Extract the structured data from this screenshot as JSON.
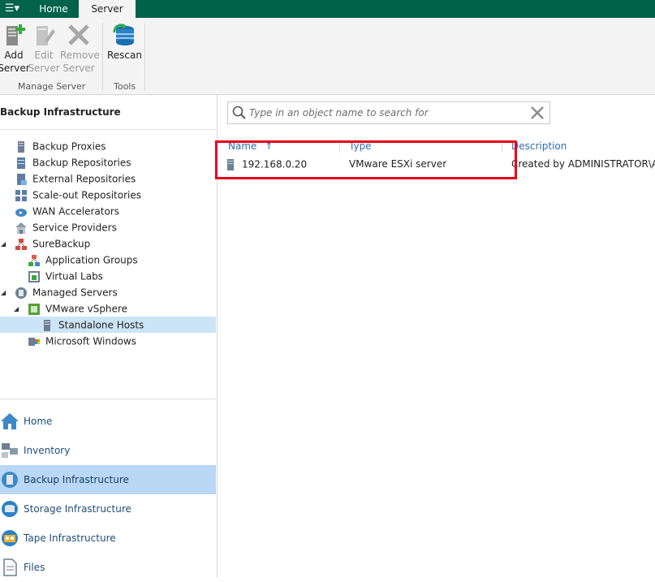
{
  "ribbon": {
    "menu_icon": "☰▾",
    "tabs": [
      {
        "label": "Home"
      },
      {
        "label": "Server"
      }
    ],
    "buttons": {
      "add_server": {
        "line1": "Add",
        "line2": "Server"
      },
      "edit_server": {
        "line1": "Edit",
        "line2": "Server"
      },
      "remove_server": {
        "line1": "Remove",
        "line2": "Server"
      },
      "rescan": {
        "line1": "Rescan"
      }
    },
    "groups": {
      "manage_server": "Manage Server",
      "tools": "Tools"
    }
  },
  "left_pane": {
    "title": "Backup Infrastructure",
    "tree": [
      {
        "label": "Backup Proxies"
      },
      {
        "label": "Backup Repositories"
      },
      {
        "label": "External Repositories"
      },
      {
        "label": "Scale-out Repositories"
      },
      {
        "label": "WAN Accelerators"
      },
      {
        "label": "Service Providers"
      },
      {
        "label": "SureBackup"
      },
      {
        "label": "Application Groups"
      },
      {
        "label": "Virtual Labs"
      },
      {
        "label": "Managed Servers"
      },
      {
        "label": "VMware vSphere"
      },
      {
        "label": "Standalone Hosts"
      },
      {
        "label": "Microsoft Windows"
      }
    ],
    "nav": [
      {
        "label": "Home"
      },
      {
        "label": "Inventory"
      },
      {
        "label": "Backup Infrastructure"
      },
      {
        "label": "Storage Infrastructure"
      },
      {
        "label": "Tape Infrastructure"
      },
      {
        "label": "Files"
      }
    ]
  },
  "search": {
    "placeholder": "Type in an object name to search for"
  },
  "table": {
    "columns": {
      "name": "Name",
      "sort_indicator": "↑",
      "type": "Type",
      "description": "Description"
    },
    "rows": [
      {
        "name": "192.168.0.20",
        "type": "VMware ESXi server",
        "description": "Created  by  ADMINISTRATOR\\Adm"
      }
    ]
  },
  "colors": {
    "ribbon_tab_bg": "#00634a",
    "highlight": "#e6001a",
    "selected": "#cce4f7",
    "nav_active": "#b8d8f5"
  }
}
